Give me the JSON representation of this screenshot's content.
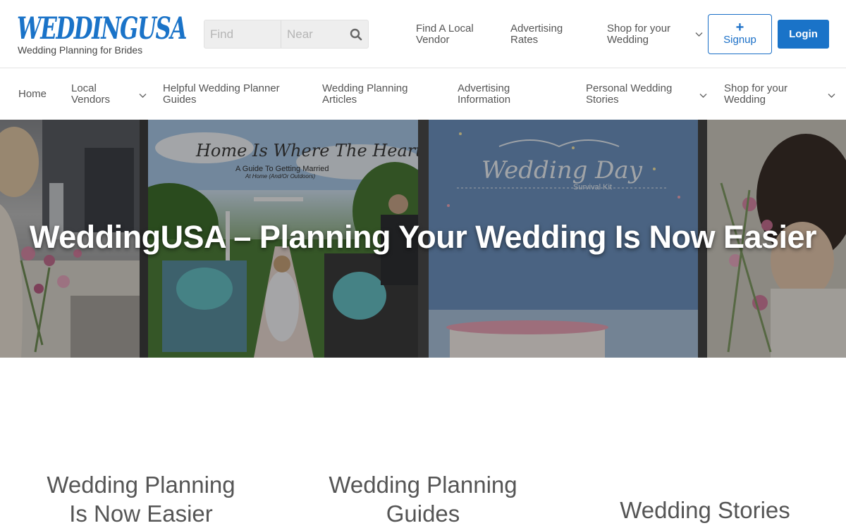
{
  "brand": {
    "logo_text": "WEDDINGUSA",
    "tagline": "Wedding Planning for Brides",
    "accent": "#1a73c8"
  },
  "search": {
    "find_placeholder": "Find",
    "near_placeholder": "Near",
    "icon": "search-icon"
  },
  "top_nav": {
    "items": [
      {
        "label": "Find A Local Vendor",
        "has_dropdown": false
      },
      {
        "label": "Advertising Rates",
        "has_dropdown": false
      },
      {
        "label": "Shop for your Wedding",
        "has_dropdown": true
      }
    ],
    "signup_icon": "+",
    "signup_label": "Signup",
    "login_label": "Login"
  },
  "main_nav": {
    "items": [
      {
        "label": "Home",
        "has_dropdown": false
      },
      {
        "label": "Local Vendors",
        "has_dropdown": true
      },
      {
        "label": "Helpful Wedding Planner Guides",
        "has_dropdown": false
      },
      {
        "label": "Wedding Planning Articles",
        "has_dropdown": false
      },
      {
        "label": "Advertising Information",
        "has_dropdown": false
      },
      {
        "label": "Personal Wedding Stories",
        "has_dropdown": true
      },
      {
        "label": "Shop for your Wedding",
        "has_dropdown": true
      }
    ]
  },
  "hero": {
    "title": "WeddingUSA – Planning Your Wedding Is Now Easier",
    "poster1_title": "Home Is Where The Heart Is",
    "poster1_subtitle": "A Guide To Getting Married",
    "poster1_note": "At Home (And/Or Outdoors)",
    "poster2_title": "Wedding Day",
    "poster2_subtitle": "Survival Kit"
  },
  "features": [
    {
      "label": "Wedding Planning Is Now Easier"
    },
    {
      "label": "Wedding Planning Guides"
    },
    {
      "label": "Wedding Stories"
    }
  ]
}
